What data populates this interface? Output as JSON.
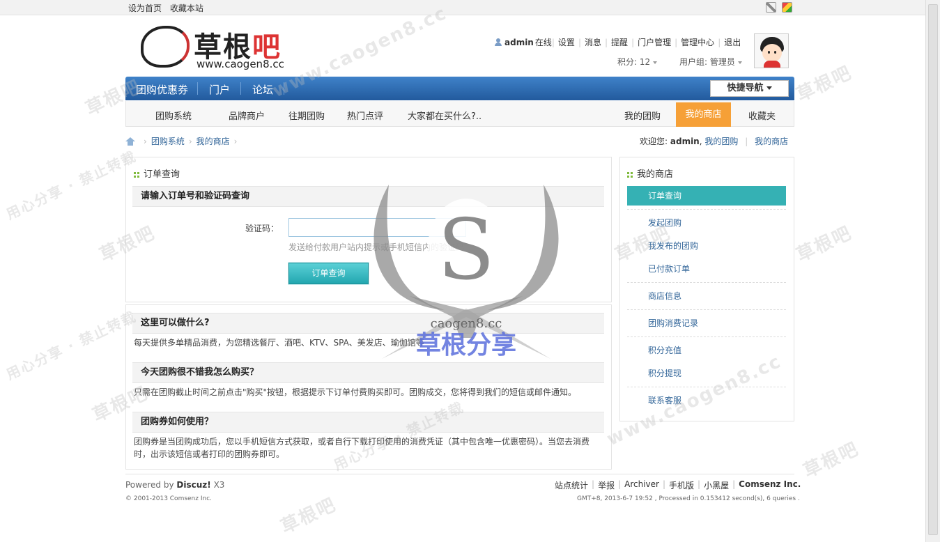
{
  "topbar": {
    "links": [
      "设为首页",
      "收藏本站"
    ],
    "icons": [
      "expand-icon",
      "color-theme-icon"
    ]
  },
  "logo": {
    "chinese": "草根",
    "chinese_red": "吧",
    "url": "www.caogen8.cc"
  },
  "user": {
    "name": "admin",
    "status": "在线",
    "menu": [
      "设置",
      "消息",
      "提醒",
      "门户管理",
      "管理中心",
      "退出"
    ],
    "credits": "积分: 12",
    "group": "用户组: 管理员"
  },
  "mainnav": {
    "items": [
      "团购优惠券",
      "门户",
      "论坛"
    ],
    "quicknav": "快捷导航"
  },
  "subnav": {
    "items": [
      "团购系统",
      "品牌商户",
      "往期团购",
      "热门点评",
      "大家都在买什么?.."
    ],
    "right_items": [
      "我的团购",
      "我的商店",
      "收藏夹"
    ],
    "active": "我的商店"
  },
  "breadcrumb": [
    "团购系统",
    "我的商店"
  ],
  "welcome": {
    "prefix": "欢迎您:",
    "user": "admin",
    "link1": "我的团购",
    "link2": "我的商店"
  },
  "order_query": {
    "title": "订单查询",
    "section": "请输入订单号和验证码查询",
    "label": "验证码：",
    "value": "",
    "hint": "发送给付款用户站内提示或手机短信内的验证码",
    "button": "订单查询"
  },
  "qa": [
    {
      "q": "这里可以做什么?",
      "a": "每天提供多单精品消费，为您精选餐厅、酒吧、KTV、SPA、美发店、瑜伽馆等"
    },
    {
      "q": "今天团购很不错我怎么购买？",
      "a": "只需在团购截止时间之前点击\"购买\"按钮，根据提示下订单付费购买即可。团购成交，您将得到我们的短信或邮件通知。"
    },
    {
      "q": "团购券如何使用？",
      "a": "团购券是当团购成功后，您以手机短信方式获取，或者自行下载打印使用的消费凭证（其中包含唯一优惠密码）。当您去消费时，出示该短信或者打印的团购券即可。"
    }
  ],
  "sidebar": {
    "title": "我的商店",
    "active": "订单查询",
    "items": [
      "发起团购",
      "我发布的团购",
      "已付款订单",
      "商店信息",
      "团购消费记录",
      "积分充值",
      "积分提现",
      "联系客服"
    ]
  },
  "footer": {
    "powered_prefix": "Powered by",
    "powered_brand": "Discuz!",
    "powered_version": "X3",
    "copyright": "© 2001-2013 Comsenz Inc.",
    "links": [
      "站点统计",
      "举报",
      "Archiver",
      "手机版",
      "小黑屋"
    ],
    "company": "Comsenz Inc.",
    "time": "GMT+8, 2013-6-7 19:52 , Processed in 0.153412 second(s), 6 queries ."
  },
  "watermark": {
    "site": "caogen8.cc",
    "brand": "草根分享",
    "repeat": [
      "草根吧",
      "www.caogen8.cc",
      "用心分享 · 禁止转载"
    ]
  },
  "colors": {
    "nav_blue": "#2f6fb6",
    "active_orange": "#f6a037",
    "teal": "#35b1b4",
    "link": "#336699"
  }
}
